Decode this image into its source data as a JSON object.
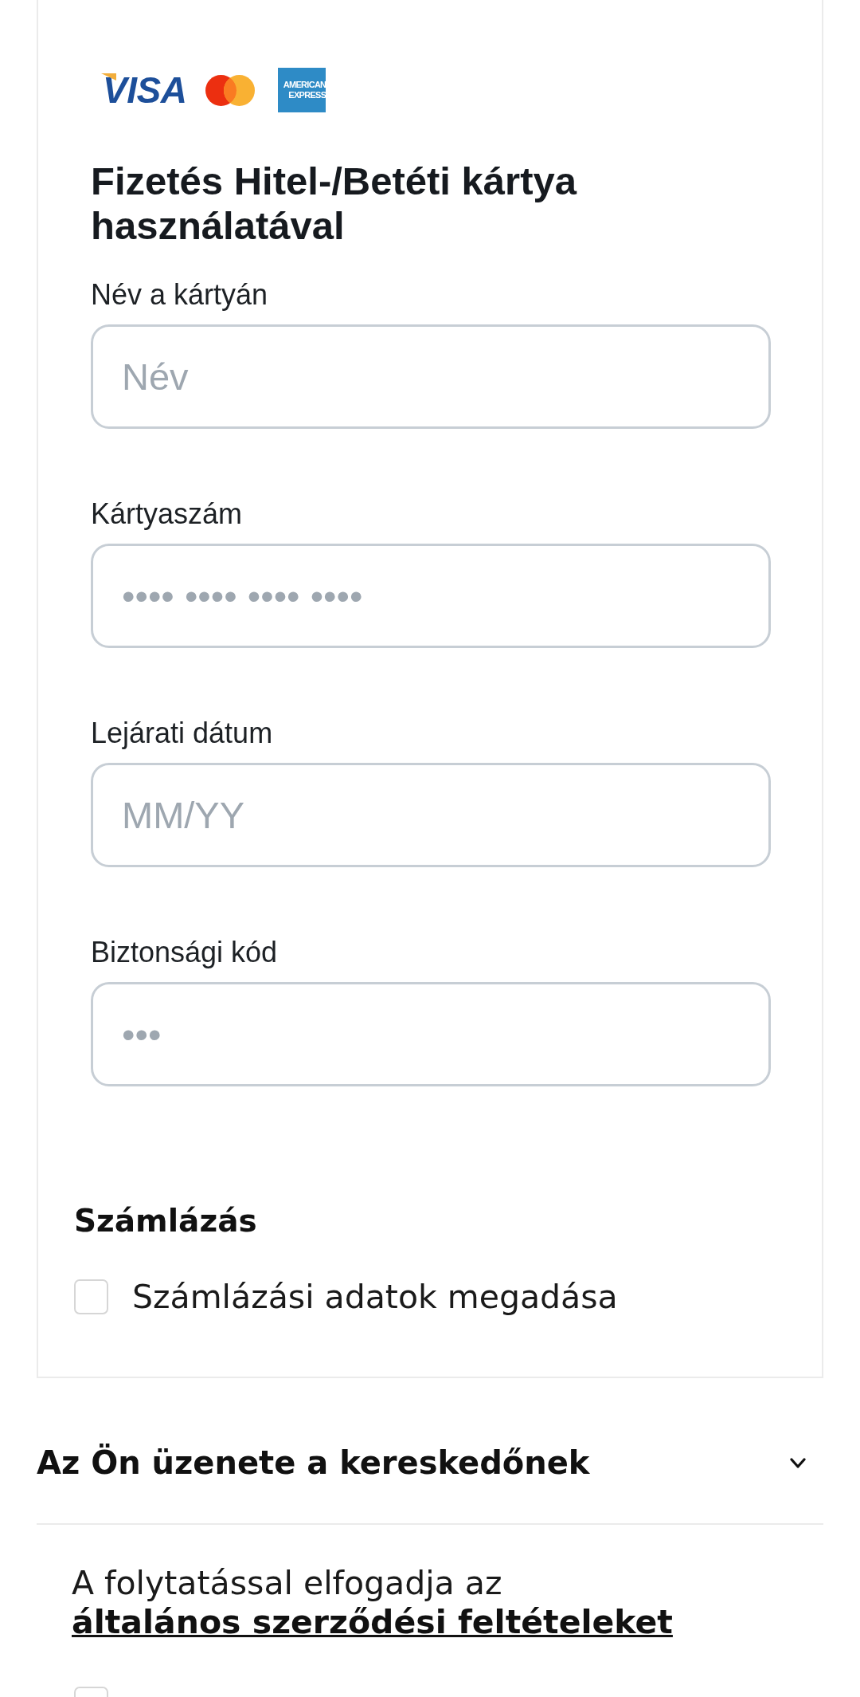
{
  "card_logos": [
    {
      "kind": "visa",
      "text": "VISA"
    },
    {
      "kind": "mastercard"
    },
    {
      "kind": "amex",
      "lines": [
        "AMERICAN",
        "EXPRESS"
      ]
    }
  ],
  "payment": {
    "title": "Fizetés Hitel-/Betéti kártya használatával",
    "fields": [
      {
        "label": "Név a kártyán",
        "placeholder": "Név"
      },
      {
        "label": "Kártyaszám",
        "placeholder": "•••• •••• •••• ••••"
      },
      {
        "label": "Lejárati dátum",
        "placeholder": "MM/YY"
      },
      {
        "label": "Biztonsági kód",
        "placeholder": "•••"
      }
    ]
  },
  "billing": {
    "title": "Számlázás",
    "checkbox": {
      "label": "Számlázási adatok megadása",
      "checked": false
    }
  },
  "message_section": {
    "title": "Az Ön üzenete a kereskedőnek",
    "expanded": false
  },
  "terms": {
    "text": "A folytatással elfogadja az",
    "link": "általános szerződési feltételeket"
  },
  "consent": {
    "checked": false
  }
}
